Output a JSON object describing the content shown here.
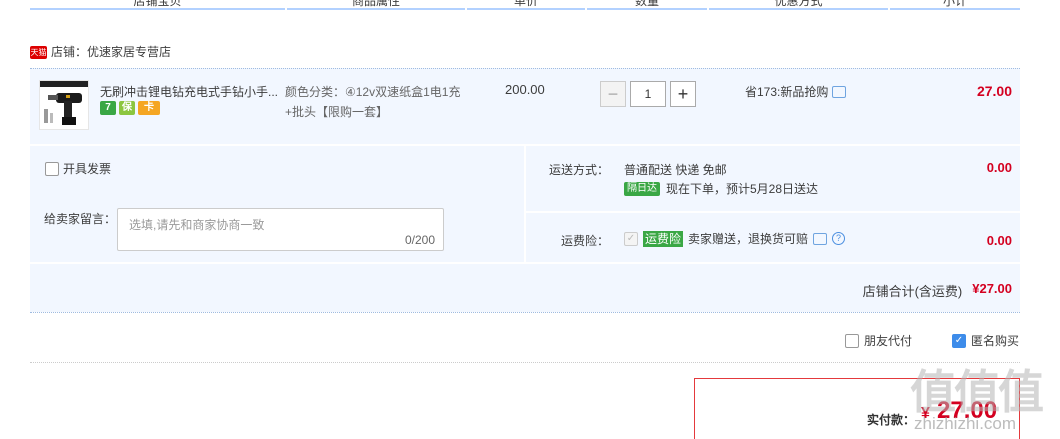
{
  "table_header": {
    "shop_item": "店铺宝贝",
    "attrs": "商品属性",
    "unit_price": "单价",
    "quantity": "数量",
    "discount": "优惠方式",
    "subtotal": "小计"
  },
  "shop": {
    "badge": "天猫",
    "label": "店铺：优速家居专营店"
  },
  "item": {
    "title": "无刷冲击锂电钻充电式手钻小手...",
    "badges": [
      "7",
      "保",
      "卡"
    ],
    "sku": "颜色分类：④12v双速纸盒1电1充+批头【限购一套】",
    "price": "200.00",
    "qty": "1",
    "minus": "−",
    "plus": "+",
    "promo": "省173:新品抢购",
    "subtotal": "27.00"
  },
  "options": {
    "invoice_label": "开具发票",
    "memo_label": "给卖家留言：",
    "memo_placeholder": "选填,请先和商家协商一致",
    "memo_count": "0/200",
    "ship_label": "运送方式：",
    "ship_method": "普通配送 快递 免邮",
    "ship_tag": "隔日达",
    "ship_eta": "现在下单，预计5月28日送达",
    "ship_fee": "0.00",
    "ins_label": "运费险：",
    "ins_tag": "运费险",
    "ins_text": "卖家赠送，退换货可赔",
    "ins_fee": "0.00",
    "shop_total_label": "店铺合计(含运费)",
    "shop_total": "¥27.00"
  },
  "extras": {
    "friend_pay": "朋友代付",
    "anonymous": "匿名购买"
  },
  "payment": {
    "label": "实付款：",
    "symbol": "¥",
    "amount": "27.00"
  },
  "watermark": {
    "logo": "值值值",
    "site": "zhizhizhi.com"
  }
}
